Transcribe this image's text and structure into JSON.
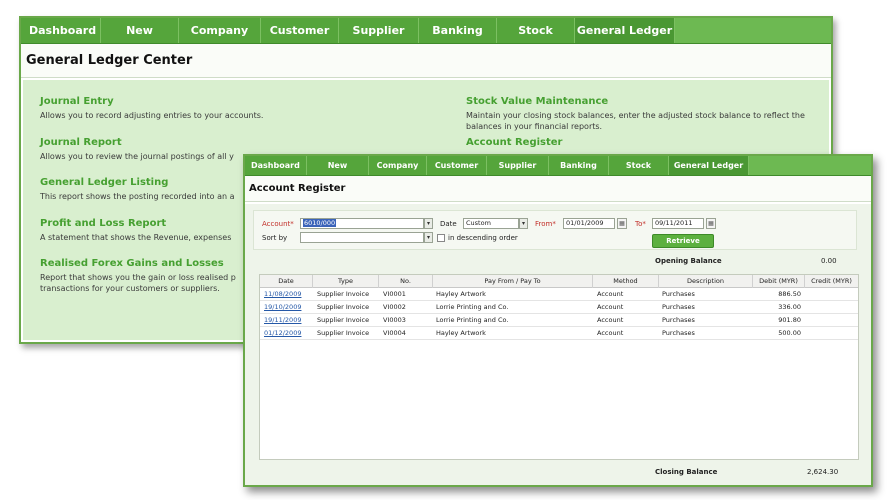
{
  "back_window": {
    "nav": [
      "Dashboard",
      "New",
      "Company",
      "Customer",
      "Supplier",
      "Banking",
      "Stock",
      "General Ledger"
    ],
    "title": "General Ledger Center",
    "sections": [
      {
        "title": "Journal Entry",
        "desc": "Allows you to record adjusting entries to your accounts."
      },
      {
        "title": "Journal Report",
        "desc": "Allows you to review the journal postings of all y"
      },
      {
        "title": "General Ledger Listing",
        "desc": "This report shows the posting recorded into an a"
      },
      {
        "title": "Profit and Loss Report",
        "desc": "A statement that shows the Revenue, expenses"
      },
      {
        "title": "Realised Forex Gains and Losses",
        "desc": "Report that shows you the gain or loss realised p transactions for your customers or suppliers."
      },
      {
        "title": "Stock Value Maintenance",
        "desc": "Maintain your closing stock balances, enter the adjusted stock balance to reflect the balances in your financial reports."
      },
      {
        "title": "Account Register",
        "desc": ""
      }
    ]
  },
  "front_window": {
    "nav": [
      "Dashboard",
      "New",
      "Company",
      "Customer",
      "Supplier",
      "Banking",
      "Stock",
      "General Ledger"
    ],
    "title": "Account Register",
    "filters": {
      "account_label": "Account*",
      "account_value": "6010/000",
      "date_label": "Date",
      "date_value": "Custom",
      "from_label": "From*",
      "from_value": "01/01/2009",
      "to_label": "To*",
      "to_value": "09/11/2011",
      "sort_label": "Sort by",
      "sort_value": "",
      "descending_label": "in descending order",
      "retrieve_label": "Retrieve"
    },
    "opening_balance_label": "Opening Balance",
    "opening_balance_value": "0.00",
    "closing_balance_label": "Closing Balance",
    "closing_balance_value": "2,624.30",
    "table": {
      "columns": [
        "Date",
        "Type",
        "No.",
        "Pay From / Pay To",
        "Method",
        "Description",
        "Debit (MYR)",
        "Credit (MYR)"
      ],
      "rows": [
        [
          "11/08/2009",
          "Supplier Invoice",
          "VI0001",
          "Hayley Artwork",
          "Account",
          "Purchases",
          "886.50",
          ""
        ],
        [
          "19/10/2009",
          "Supplier Invoice",
          "VI0002",
          "Lorrie Printing and Co.",
          "Account",
          "Purchases",
          "336.00",
          ""
        ],
        [
          "19/11/2009",
          "Supplier Invoice",
          "VI0003",
          "Lorrie Printing and Co.",
          "Account",
          "Purchases",
          "901.80",
          ""
        ],
        [
          "01/12/2009",
          "Supplier Invoice",
          "VI0004",
          "Hayley Artwork",
          "Account",
          "Purchases",
          "500.00",
          ""
        ]
      ]
    }
  },
  "colors": {
    "nav_green": "#55a53b",
    "section_title_green": "#46a031",
    "back_body_bg": "#d9efcf",
    "link_blue": "#2558a7",
    "required_red": "#c2302a"
  }
}
